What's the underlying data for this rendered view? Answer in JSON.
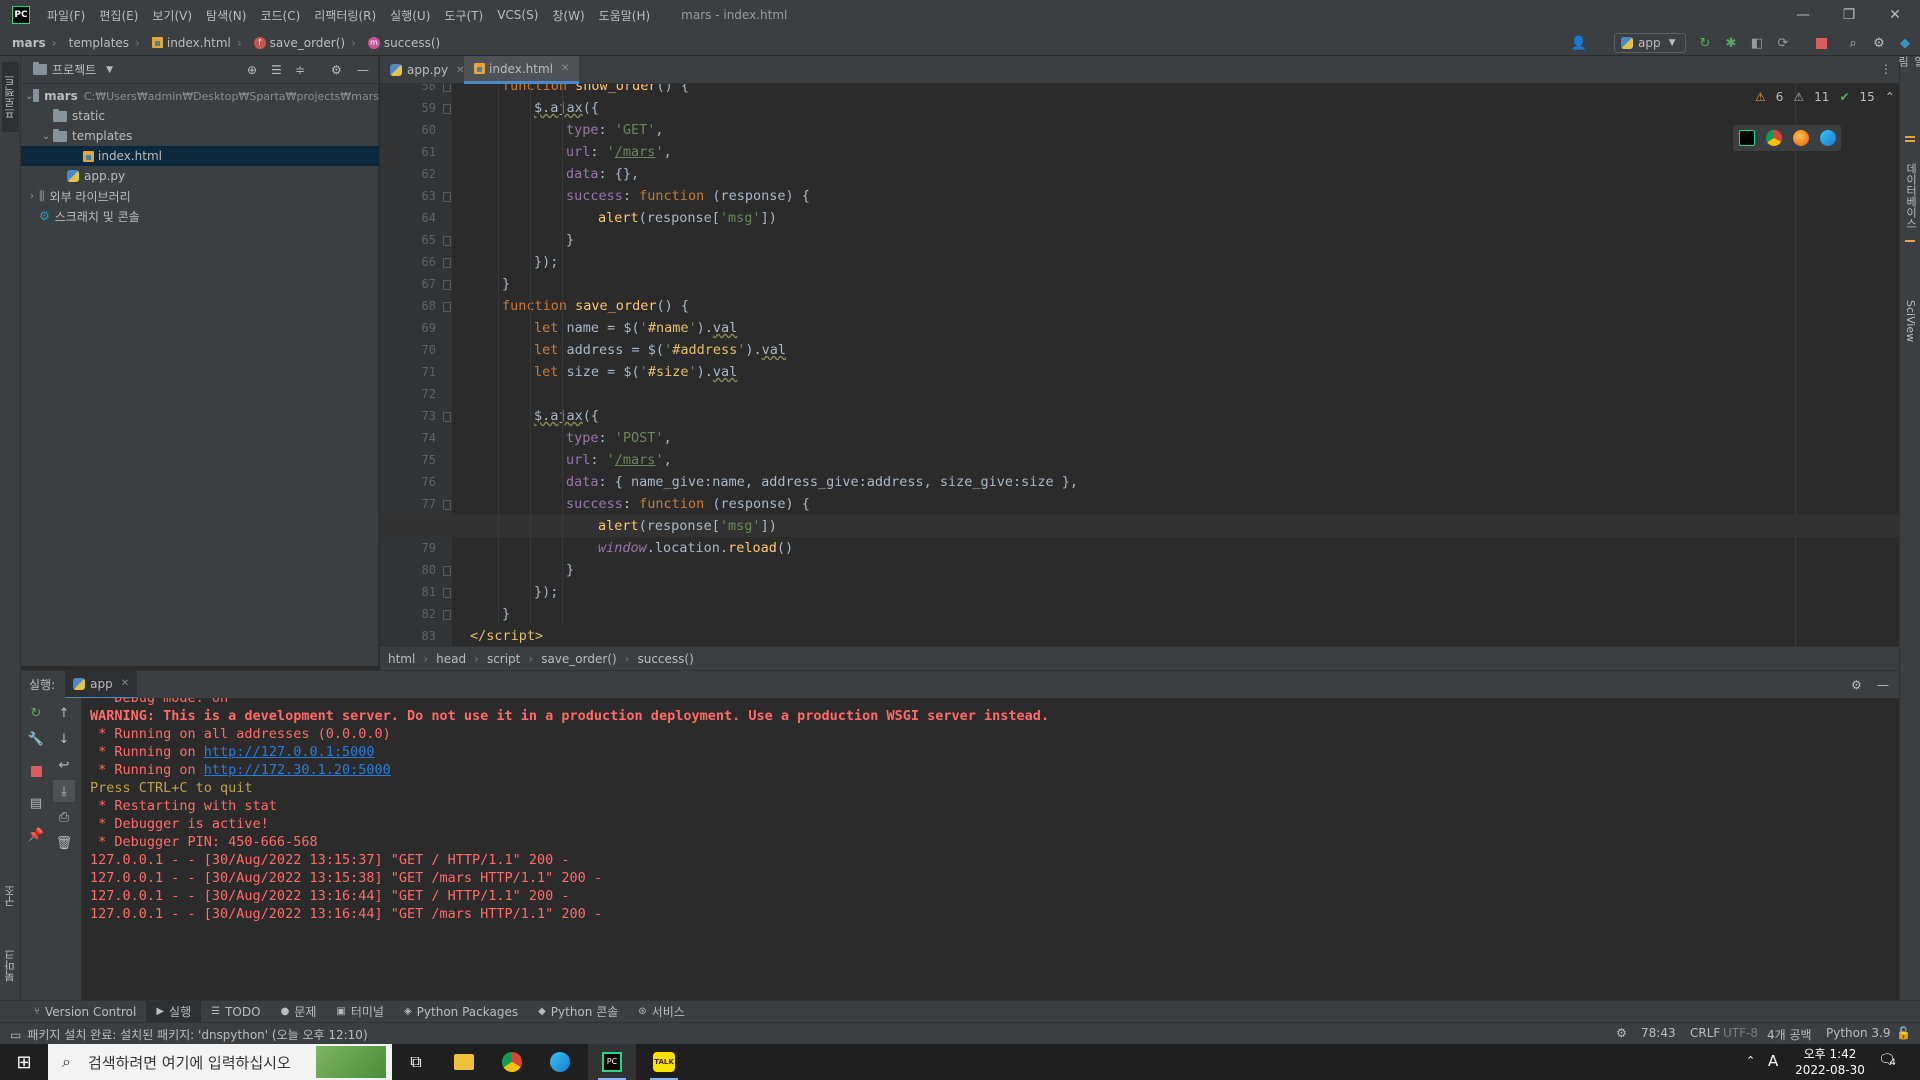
{
  "app": {
    "logo": "PC",
    "title": "mars - index.html",
    "menus": [
      "파일(F)",
      "편집(E)",
      "보기(V)",
      "탐색(N)",
      "코드(C)",
      "리팩터링(R)",
      "실행(U)",
      "도구(T)",
      "VCS(S)",
      "창(W)",
      "도움말(H)"
    ]
  },
  "navbar": {
    "crumbs": [
      "mars",
      "templates",
      "index.html",
      "save_order()",
      "success()"
    ],
    "run_config": "app"
  },
  "leftstripe": {
    "project_tab": "프로젝트",
    "structure_tab": "구조",
    "bookmarks_tab": "북마크"
  },
  "rightstripe": {
    "db_tab": "데이터베이스",
    "sciview_tab": "SciView",
    "notifications_tab": "알림"
  },
  "project": {
    "header": "프로젝트",
    "root_name": "mars",
    "root_path": "C:₩Users₩admin₩Desktop₩Sparta₩projects₩mars",
    "items": [
      "static",
      "templates",
      "index.html",
      "app.py",
      "외부 라이브러리",
      "스크래치 및 콘솔"
    ]
  },
  "editor": {
    "tabs": [
      "app.py",
      "index.html"
    ],
    "inspections": {
      "warnings": "6",
      "weak_warnings": "11",
      "ok": "15"
    },
    "lines": [
      {
        "n": "58",
        "ind": 1,
        "html": "<span class='kw'>function</span> <span class='fn'>show_order</span>() {"
      },
      {
        "n": "59",
        "ind": 2,
        "html": "<span class='und'>$.ajax</span>({"
      },
      {
        "n": "60",
        "ind": 3,
        "html": "<span class='prop'>type</span>: <span class='str'>'GET'</span>,"
      },
      {
        "n": "61",
        "ind": 3,
        "html": "<span class='prop'>url</span>: <span class='str'>'<span class=\"lnk\">/mars</span>'</span>,"
      },
      {
        "n": "62",
        "ind": 3,
        "html": "<span class='prop'>data</span>: {},"
      },
      {
        "n": "63",
        "ind": 3,
        "html": "<span class='prop'>success</span>: <span class='kw'>function</span> (response) {"
      },
      {
        "n": "64",
        "ind": 4,
        "html": "<span class='fn'>alert</span>(response[<span class='str'>'msg'</span>])"
      },
      {
        "n": "65",
        "ind": 3,
        "html": "}"
      },
      {
        "n": "66",
        "ind": 2,
        "html": "});"
      },
      {
        "n": "67",
        "ind": 1,
        "html": "}"
      },
      {
        "n": "68",
        "ind": 1,
        "html": "<span class='kw'>function</span> <span class='fn'>save_order</span>() {"
      },
      {
        "n": "69",
        "ind": 2,
        "html": "<span class='kw'>let</span> name = $(<span class='str'>'<span class=\"strh\">#name</span>'</span>).<span class='und'>val</span>"
      },
      {
        "n": "70",
        "ind": 2,
        "html": "<span class='kw'>let</span> address = $(<span class='str'>'<span class=\"strh\">#address</span>'</span>).<span class='und'>val</span>"
      },
      {
        "n": "71",
        "ind": 2,
        "html": "<span class='kw'>let</span> size = $(<span class='str'>'<span class=\"strh\">#size</span>'</span>).<span class='und'>val</span>"
      },
      {
        "n": "72",
        "ind": 0,
        "html": ""
      },
      {
        "n": "73",
        "ind": 2,
        "html": "<span class='und'>$.ajax</span>({"
      },
      {
        "n": "74",
        "ind": 3,
        "html": "<span class='prop'>type</span>: <span class='str'>'POST'</span>,"
      },
      {
        "n": "75",
        "ind": 3,
        "html": "<span class='prop'>url</span>: <span class='str'>'<span class=\"lnk\">/mars</span>'</span>,"
      },
      {
        "n": "76",
        "ind": 3,
        "html": "<span class='prop'>data</span>: { name_give:name, address_give:address, size_give:size },"
      },
      {
        "n": "77",
        "ind": 3,
        "html": "<span class='prop'>success</span>: <span class='kw'>function</span> (response) {"
      },
      {
        "n": "78",
        "ind": 4,
        "html": "<span class='fn'>alert</span>(response[<span class='str'>'msg'</span>])",
        "cur": true
      },
      {
        "n": "79",
        "ind": 4,
        "html": "<span class='wv'>window</span>.location.<span class='fn'>reload</span>()"
      },
      {
        "n": "80",
        "ind": 3,
        "html": "}"
      },
      {
        "n": "81",
        "ind": 2,
        "html": "});"
      },
      {
        "n": "82",
        "ind": 1,
        "html": "}"
      },
      {
        "n": "83",
        "ind": 0,
        "html": "<span class='tag'>&lt;/script&gt;</span>"
      }
    ],
    "breadcrumbs": [
      "html",
      "head",
      "script",
      "save_order()",
      "success()"
    ]
  },
  "run": {
    "label": "실행:",
    "tab": "app",
    "lines": [
      {
        "cls": "err",
        "text": " * Debug mode: on"
      },
      {
        "cls": "warnb",
        "text": "WARNING: This is a development server. Do not use it in a production deployment. Use a production WSGI server instead."
      },
      {
        "cls": "err",
        "text": " * Running on all addresses (0.0.0.0)"
      },
      {
        "cls": "err",
        "text": " * Running on ",
        "link": "http://127.0.0.1:5000"
      },
      {
        "cls": "err",
        "text": " * Running on ",
        "link": "http://172.30.1.20:5000"
      },
      {
        "cls": "yel",
        "text": "Press CTRL+C to quit"
      },
      {
        "cls": "err",
        "text": " * Restarting with stat"
      },
      {
        "cls": "err",
        "text": " * Debugger is active!"
      },
      {
        "cls": "err",
        "text": " * Debugger PIN: 450-666-568"
      },
      {
        "cls": "err",
        "text": "127.0.0.1 - - [30/Aug/2022 13:15:37] \"GET / HTTP/1.1\" 200 -"
      },
      {
        "cls": "err",
        "text": "127.0.0.1 - - [30/Aug/2022 13:15:38] \"GET /mars HTTP/1.1\" 200 -"
      },
      {
        "cls": "err",
        "text": "127.0.0.1 - - [30/Aug/2022 13:16:44] \"GET / HTTP/1.1\" 200 -"
      },
      {
        "cls": "err",
        "text": "127.0.0.1 - - [30/Aug/2022 13:16:44] \"GET /mars HTTP/1.1\" 200 -"
      }
    ]
  },
  "toolwindows": [
    "Version Control",
    "실행",
    "TODO",
    "문제",
    "터미널",
    "Python Packages",
    "Python 콘솔",
    "서비스"
  ],
  "status": {
    "message": "패키지 설치 완료: 설치된 패키지: 'dnspython' (오늘 오후 12:10)",
    "position": "78:43",
    "line_sep": "CRLF",
    "encoding": "UTF-8",
    "indent": "4개 공백",
    "interpreter": "Python 3.9"
  },
  "taskbar": {
    "search_placeholder": "검색하려면 여기에 입력하십시오",
    "ime": "A",
    "time": "오후 1:42",
    "date": "2022-08-30",
    "notif_count": "4"
  }
}
